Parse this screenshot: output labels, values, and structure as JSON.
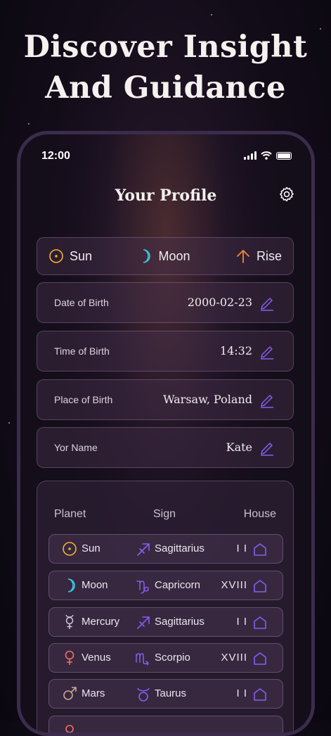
{
  "headline": {
    "line1": "Discover Insight",
    "line2": "And Guidance"
  },
  "status": {
    "time": "12:00"
  },
  "profile": {
    "title": "Your Profile"
  },
  "trio": [
    {
      "label": "Sun",
      "icon": "sun-icon",
      "color": "#f2b233"
    },
    {
      "label": "Moon",
      "icon": "moon-icon",
      "color": "#3fc7e0"
    },
    {
      "label": "Rise",
      "icon": "arrow-up-icon",
      "color": "#f28a2e"
    }
  ],
  "fields": [
    {
      "label": "Date of Birth",
      "value": "2000-02-23"
    },
    {
      "label": "Time of Birth",
      "value": "14:32"
    },
    {
      "label": "Place of Birth",
      "value": "Warsaw, Poland"
    },
    {
      "label": "Yor Name",
      "value": "Kate"
    }
  ],
  "table": {
    "headers": {
      "planet": "Planet",
      "sign": "Sign",
      "house": "House"
    },
    "rows": [
      {
        "planet": "Sun",
        "planet_icon": "sun-icon",
        "sign": "Sagittarius",
        "sign_icon": "sagittarius-icon",
        "house": "I I"
      },
      {
        "planet": "Moon",
        "planet_icon": "moon-icon",
        "sign": "Capricorn",
        "sign_icon": "capricorn-icon",
        "house": "XVIII"
      },
      {
        "planet": "Mercury",
        "planet_icon": "mercury-icon",
        "sign": "Sagittarius",
        "sign_icon": "sagittarius-icon",
        "house": "I I"
      },
      {
        "planet": "Venus",
        "planet_icon": "venus-icon",
        "sign": "Scorpio",
        "sign_icon": "scorpio-icon",
        "house": "XVIII"
      },
      {
        "planet": "Mars",
        "planet_icon": "mars-icon",
        "sign": "Taurus",
        "sign_icon": "taurus-icon",
        "house": "I I"
      }
    ]
  },
  "colors": {
    "accent": "#8a5cf0",
    "sun": "#f2b233",
    "moon": "#3fc7e0",
    "venus": "#f07060",
    "mars": "#c9a58e",
    "mercury": "#cfc9d3"
  }
}
